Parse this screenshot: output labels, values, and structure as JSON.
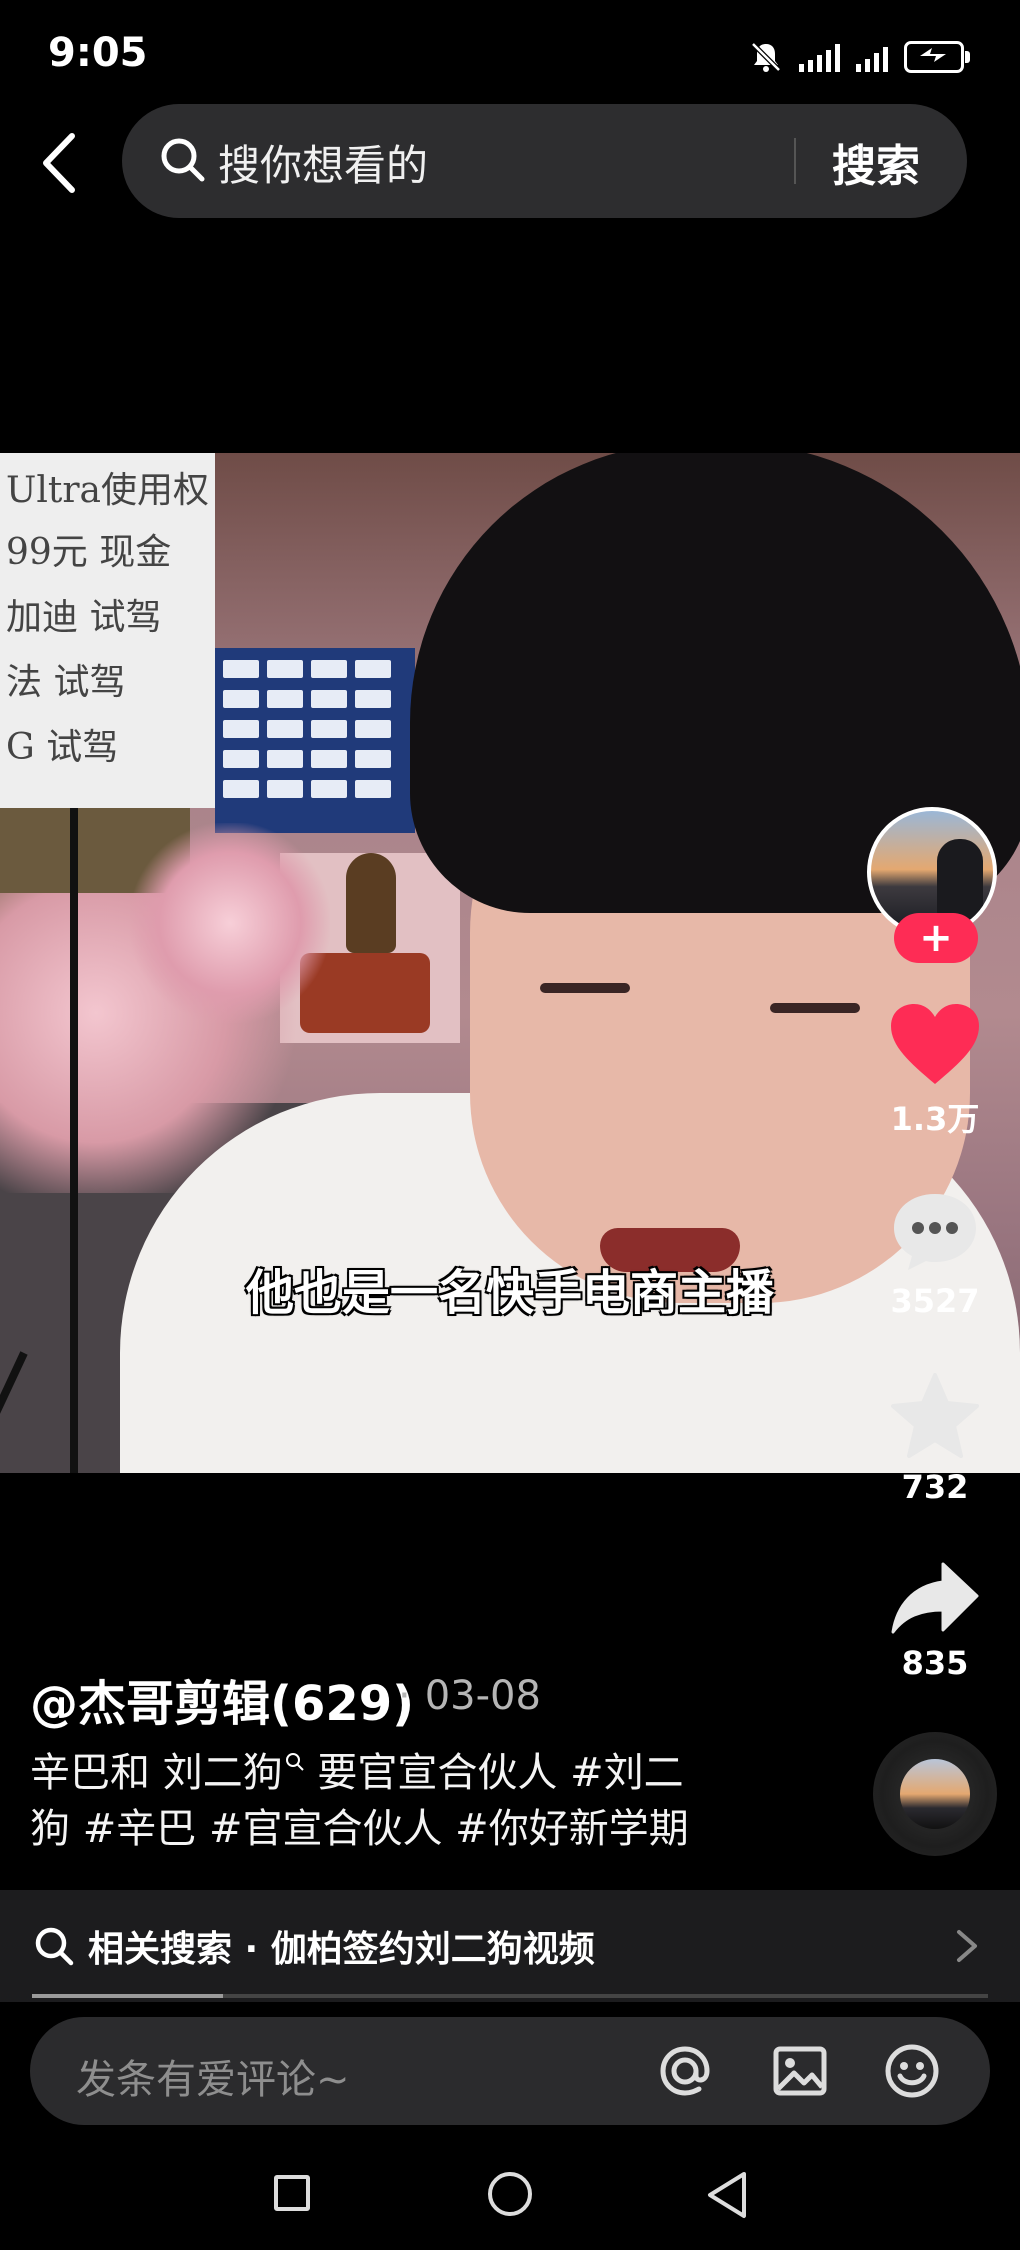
{
  "status_bar": {
    "time": "9:05",
    "icons": [
      "mute-icon",
      "signal-icon",
      "signal-icon",
      "battery-charging-icon"
    ]
  },
  "search": {
    "placeholder": "搜你想看的",
    "button": "搜索"
  },
  "video": {
    "caption": "他也是一名快手电商主播",
    "board_lines": [
      "Ultra使用权",
      "99元 现金",
      "加迪 试驾",
      "法 试驾",
      "G 试驾"
    ]
  },
  "actions": {
    "follow_symbol": "+",
    "likes": "1.3万",
    "comments": "3527",
    "favorites": "732",
    "shares": "835",
    "like_color": "#fe2c55"
  },
  "post": {
    "author": "@杰哥剪辑(629)",
    "separator": "·",
    "date": "03-08",
    "desc_line1_a": "辛巴和 刘二狗",
    "desc_line1_b": " 要官宣合伙人 #刘二",
    "desc_line2": "狗 #辛巴 #官宣合伙人 #你好新学期"
  },
  "related": {
    "text": "相关搜索 · 伽柏签约刘二狗视频",
    "progress": 0.2
  },
  "comment": {
    "placeholder": "发条有爱评论~"
  }
}
